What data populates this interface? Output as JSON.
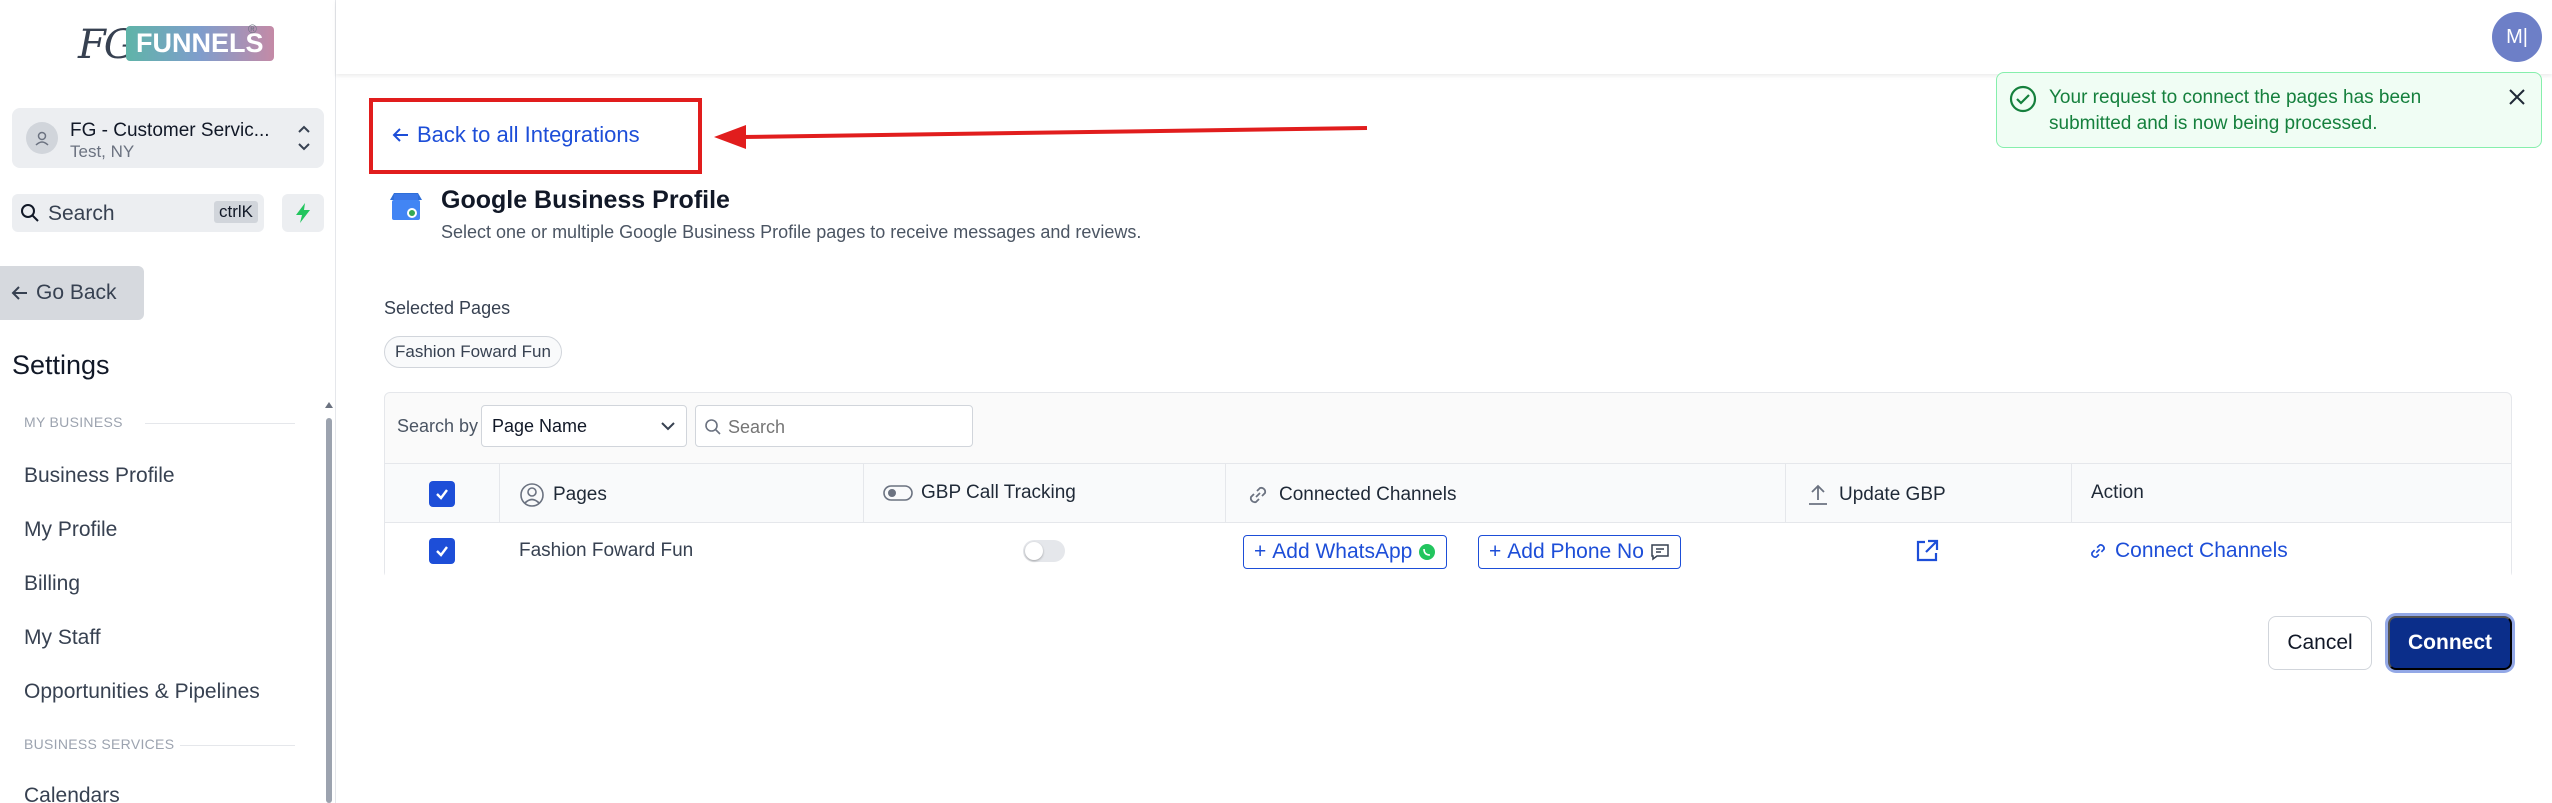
{
  "brand": {
    "logo_prefix": "FG",
    "logo_word": "FUNNELS",
    "logo_mark": "®"
  },
  "location": {
    "name": "FG - Customer Servic...",
    "sub": "Test, NY"
  },
  "sidebar_search": {
    "label": "Search",
    "shortcut": "ctrlK"
  },
  "sidebar": {
    "go_back": "Go Back",
    "title": "Settings",
    "sections": [
      {
        "header": "MY BUSINESS",
        "items": [
          "Business Profile",
          "My Profile",
          "Billing",
          "My Staff",
          "Opportunities & Pipelines"
        ]
      },
      {
        "header": "BUSINESS SERVICES",
        "items": [
          "Calendars"
        ]
      }
    ]
  },
  "user": {
    "initials": "M|"
  },
  "back_link": "Back to all Integrations",
  "toast": {
    "message": "Your request to connect the pages has been submitted and is now being processed."
  },
  "integration": {
    "title": "Google Business Profile",
    "description": "Select one or multiple Google Business Profile pages to receive messages and reviews."
  },
  "selected": {
    "label": "Selected Pages",
    "chips": [
      "Fashion Foward Fun"
    ]
  },
  "table": {
    "search_by_label": "Search by",
    "search_by_value": "Page Name",
    "search_placeholder": "Search",
    "headers": {
      "pages": "Pages",
      "call_tracking": "GBP Call Tracking",
      "channels": "Connected Channels",
      "update": "Update GBP",
      "action": "Action"
    },
    "rows": [
      {
        "page": "Fashion Foward Fun",
        "call_tracking": false,
        "add_whatsapp": "Add WhatsApp",
        "add_phone": "Add Phone No",
        "action": "Connect Channels"
      }
    ]
  },
  "footer": {
    "cancel": "Cancel",
    "connect": "Connect"
  },
  "colors": {
    "primary": "#1d4ed8",
    "connect_btn": "#0b2e8a",
    "annotation_red": "#e11d1d",
    "toast_green": "#15803d",
    "whatsapp_green": "#22c55e"
  }
}
